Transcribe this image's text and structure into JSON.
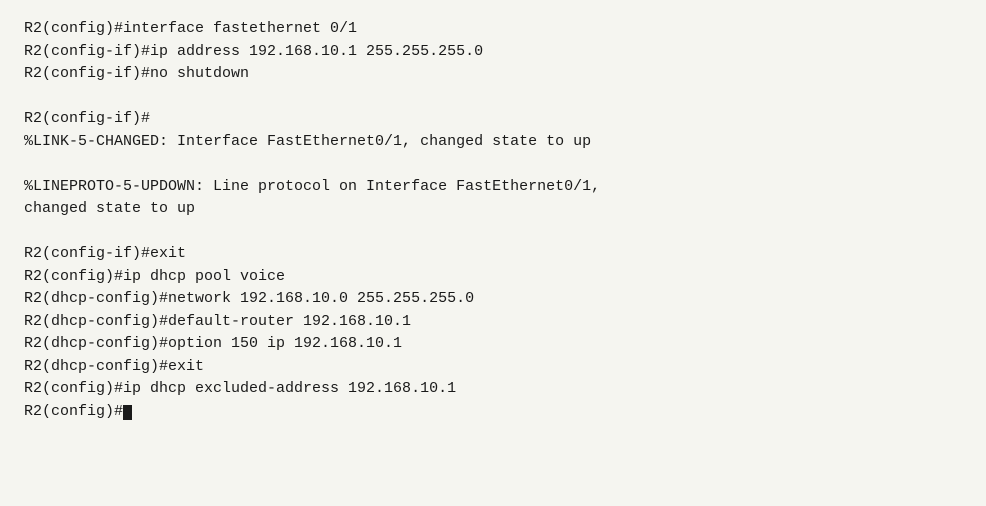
{
  "terminal": {
    "lines": [
      "R2(config)#interface fastethernet 0/1",
      "R2(config-if)#ip address 192.168.10.1 255.255.255.0",
      "R2(config-if)#no shutdown",
      "",
      "R2(config-if)#",
      "%LINK-5-CHANGED: Interface FastEthernet0/1, changed state to up",
      "",
      "%LINEPROTO-5-UPDOWN: Line protocol on Interface FastEthernet0/1,",
      "changed state to up",
      "",
      "R2(config-if)#exit",
      "R2(config)#ip dhcp pool voice",
      "R2(dhcp-config)#network 192.168.10.0 255.255.255.0",
      "R2(dhcp-config)#default-router 192.168.10.1",
      "R2(dhcp-config)#option 150 ip 192.168.10.1",
      "R2(dhcp-config)#exit",
      "R2(config)#ip dhcp excluded-address 192.168.10.1",
      "R2(config)#"
    ],
    "last_line_has_cursor": true
  }
}
